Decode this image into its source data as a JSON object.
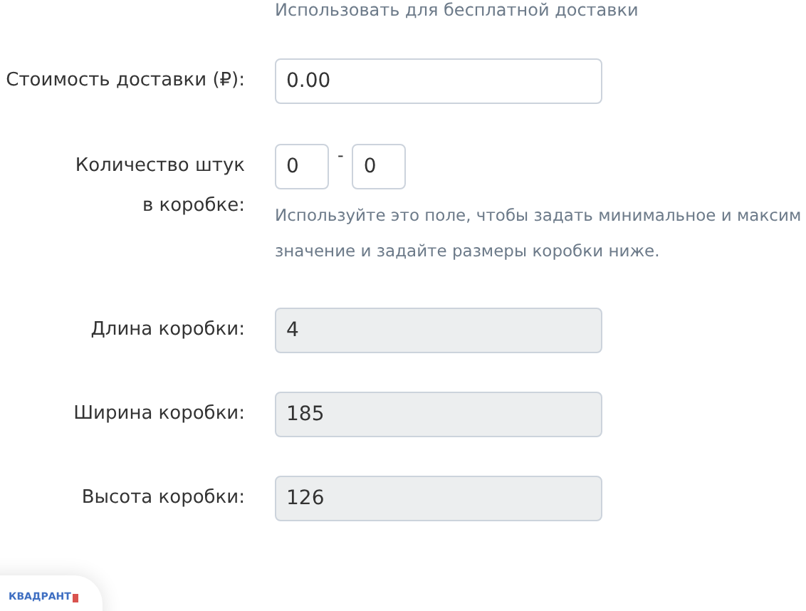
{
  "top_note": "Использовать для бесплатной доставки",
  "fields": [
    {
      "kind": "text",
      "label": "Стоимость доставки (₽):",
      "value": "0.00",
      "disabled": false
    },
    {
      "kind": "range",
      "label": "Количество штук в коробке:",
      "min": "0",
      "separator": "-",
      "max": "0",
      "hint_lines": [
        "Используйте это поле, чтобы задать минимальное и максим",
        "значение и задайте размеры коробки ниже."
      ]
    },
    {
      "kind": "text",
      "label": "Длина коробки:",
      "value": "4",
      "disabled": true
    },
    {
      "kind": "text",
      "label": "Ширина коробки:",
      "value": "185",
      "disabled": true
    },
    {
      "kind": "text",
      "label": "Высота коробки:",
      "value": "126",
      "disabled": true
    }
  ],
  "logo": {
    "text": "КВАДРАНТ"
  }
}
